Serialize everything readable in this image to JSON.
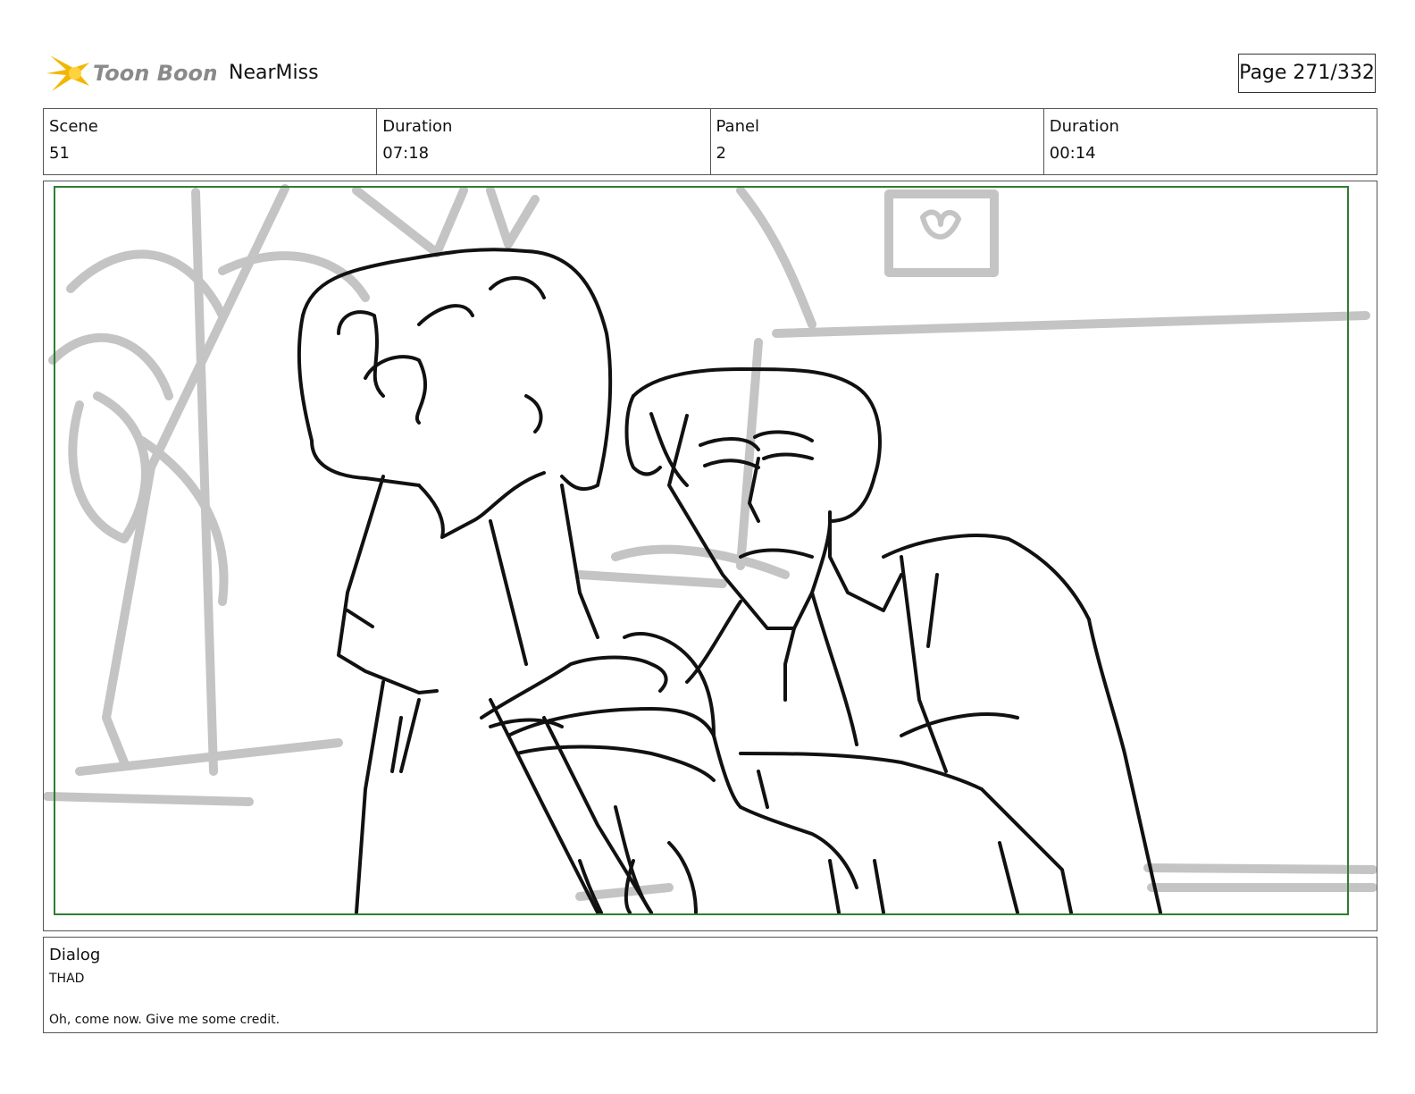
{
  "header": {
    "logo_text": "Toon Boom",
    "project_title": "NearMiss",
    "page_label": "Page 271/332"
  },
  "info": {
    "scene_label": "Scene",
    "scene_value": "51",
    "scene_duration_label": "Duration",
    "scene_duration_value": "07:18",
    "panel_label": "Panel",
    "panel_value": "2",
    "panel_duration_label": "Duration",
    "panel_duration_value": "00:14"
  },
  "dialog": {
    "label": "Dialog",
    "speaker": "THAD",
    "line": "Oh, come now. Give me some credit."
  },
  "colors": {
    "safe_frame": "#2e7d32",
    "background_sketch": "#c4c4c4",
    "ink": "#111111",
    "logo_star": "#f2b705",
    "logo_text": "#8a8a8a"
  }
}
